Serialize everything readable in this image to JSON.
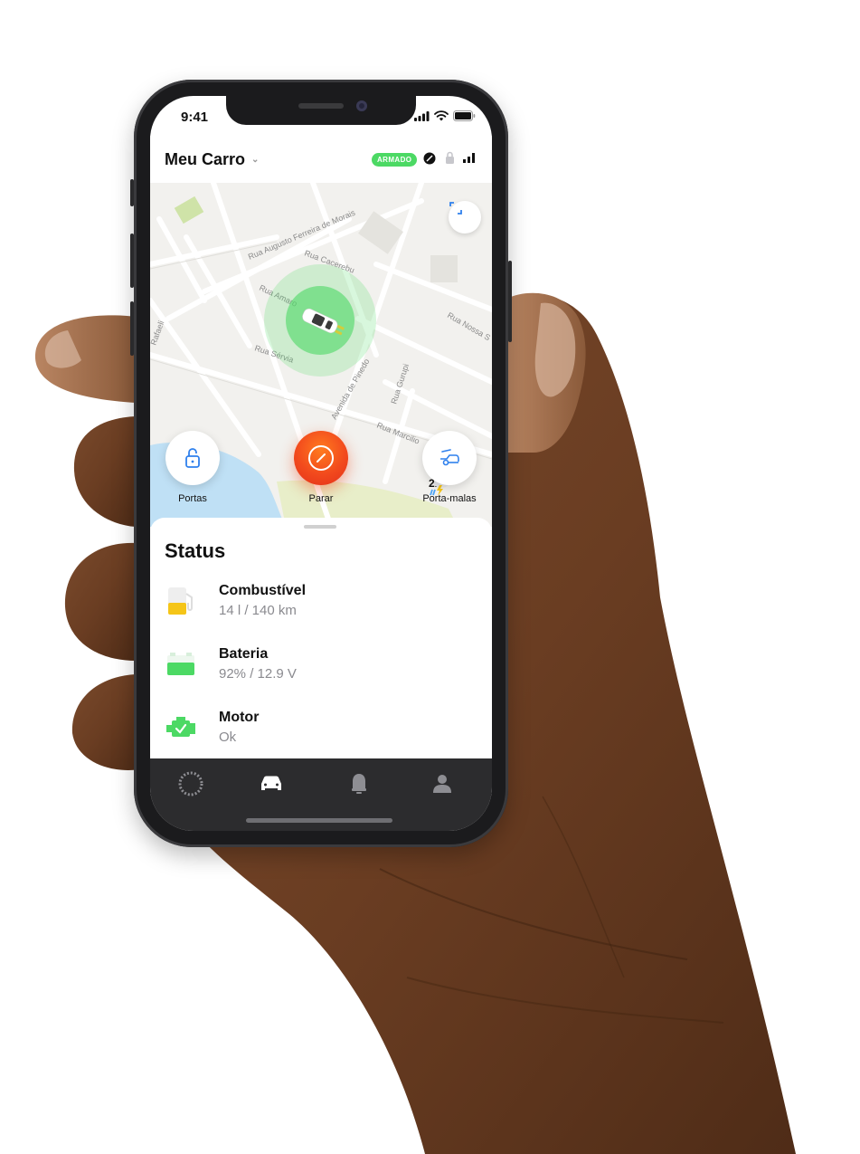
{
  "status_bar": {
    "time": "9:41"
  },
  "header": {
    "title": "Meu Carro",
    "badge": "ARMADO"
  },
  "map": {
    "streets": [
      "Rua Augusto Ferreira de Morais",
      "Rua Cacerebu",
      "Rua Amaro",
      "Rua Sérvia",
      "Avenida de Pinedo",
      "Rua Gurupi",
      "Rua Marcilio",
      "Rua Nossa S",
      "Rafaeli"
    ],
    "weather_temp": "21°"
  },
  "actions": {
    "doors_label": "Portas",
    "stop_label": "Parar",
    "trunk_label": "Porta-malas"
  },
  "status": {
    "title": "Status",
    "items": [
      {
        "name": "Combustível",
        "value": "14 l / 140 km",
        "icon": "fuel-pump-icon"
      },
      {
        "name": "Bateria",
        "value": "92% / 12.9 V",
        "icon": "battery-icon"
      },
      {
        "name": "Motor",
        "value": "Ok",
        "icon": "engine-icon"
      }
    ]
  },
  "colors": {
    "accent_green": "#4cd964",
    "stop_orange": "#f24a1d",
    "fuel_yellow": "#f5c518",
    "tabbar_bg": "#2c2c2e",
    "link_blue": "#2f80ed"
  },
  "tabs": [
    {
      "icon": "dashboard-dial-icon"
    },
    {
      "icon": "car-icon",
      "active": true
    },
    {
      "icon": "bell-icon"
    },
    {
      "icon": "profile-icon"
    }
  ]
}
